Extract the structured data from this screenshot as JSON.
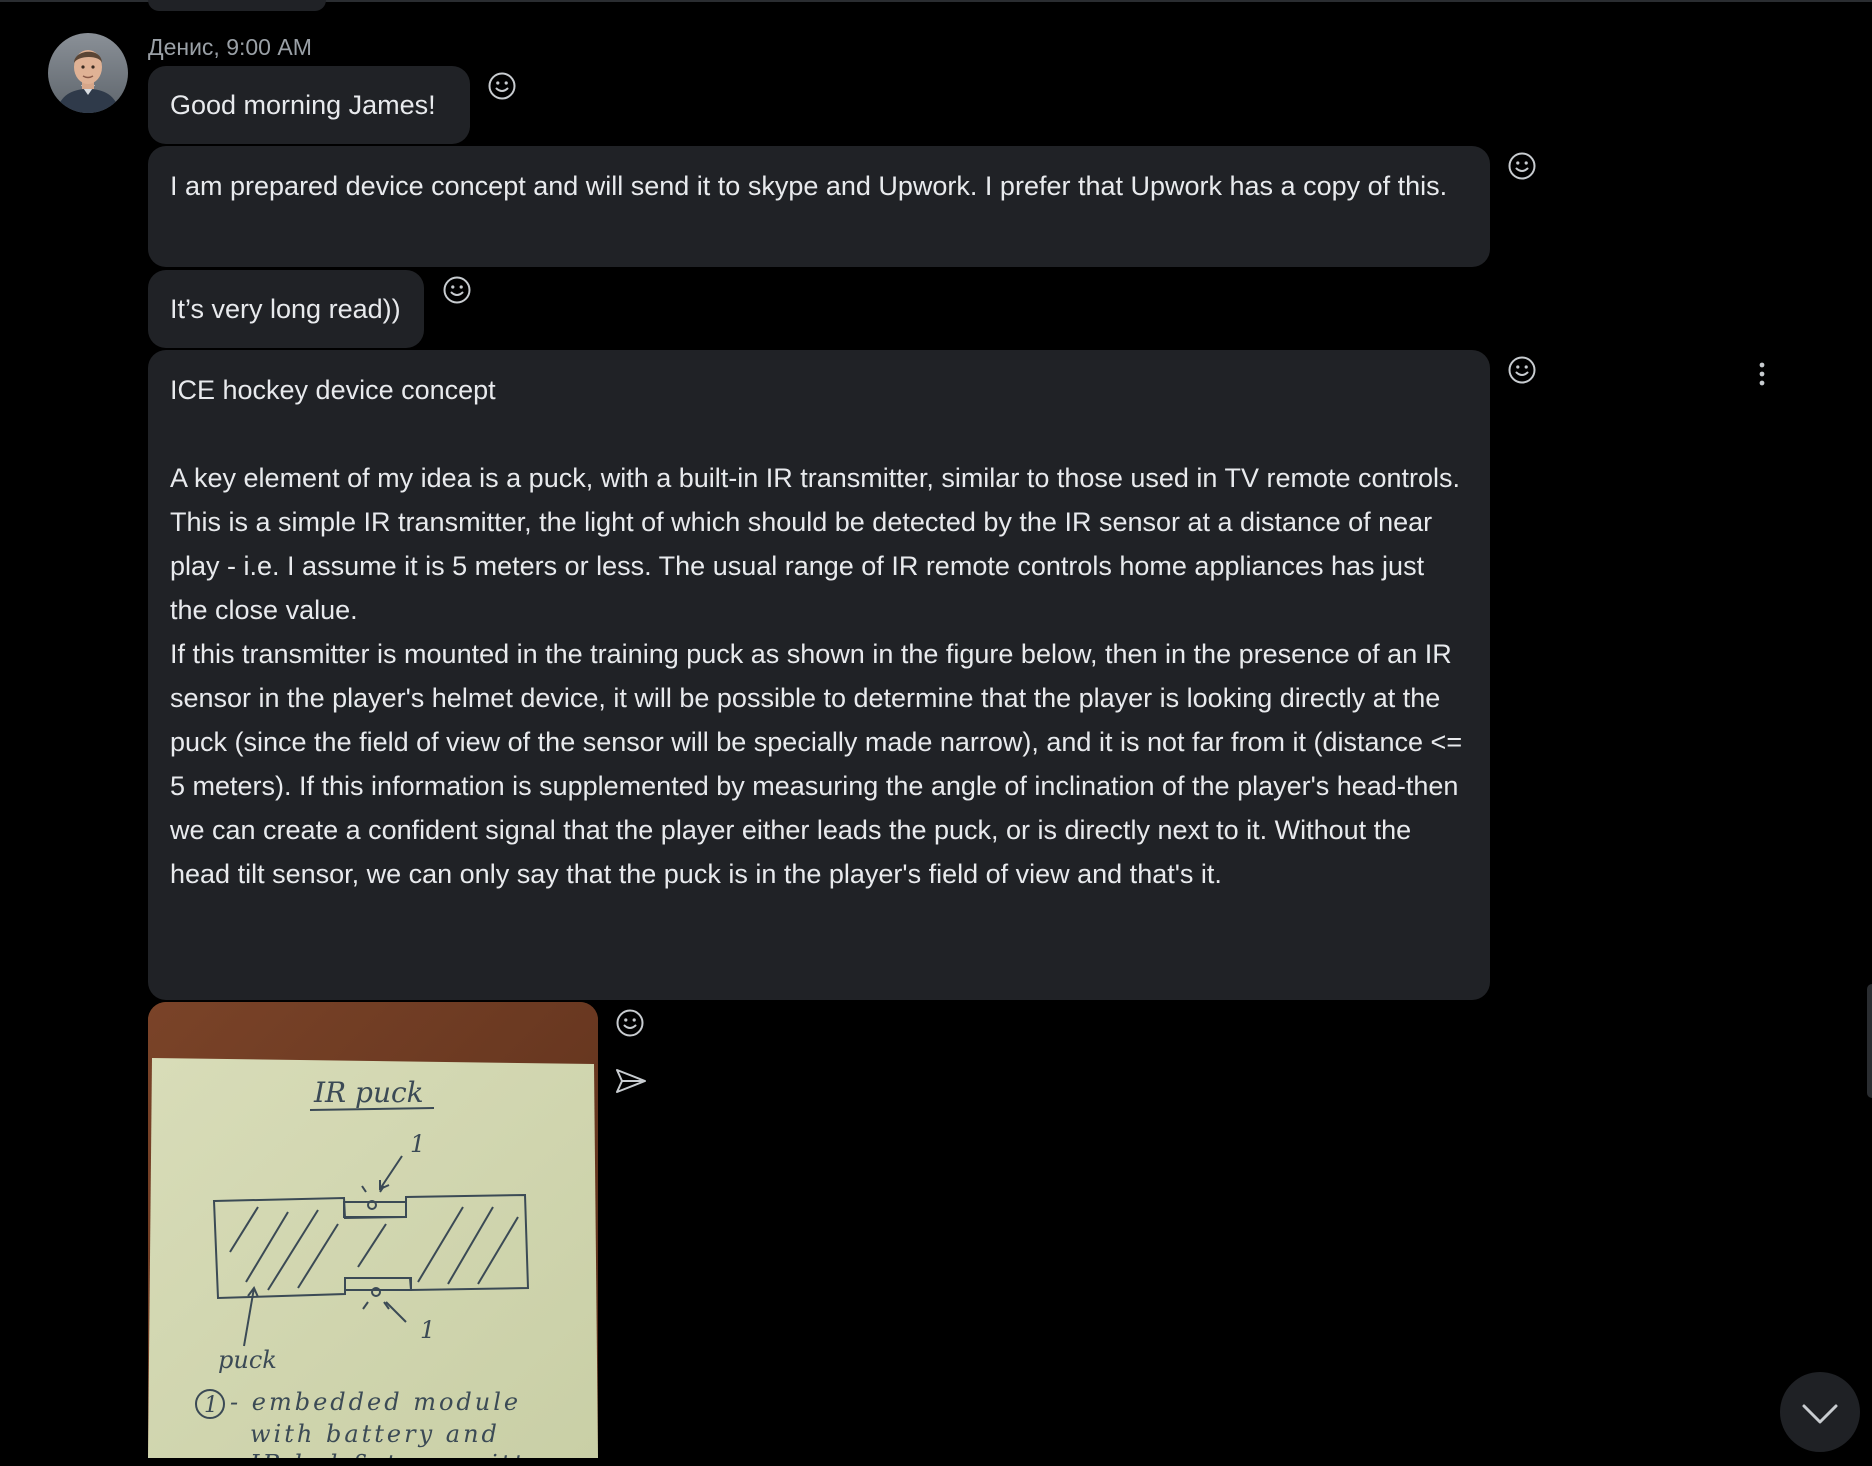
{
  "message_group": {
    "sender": "Денис",
    "time": "9:00 AM",
    "meta": "Денис, 9:00 AM"
  },
  "messages": [
    {
      "text": "Good morning James!"
    },
    {
      "text": "I am prepared device concept and will send it to skype and Upwork.  I prefer that Upwork has a copy of this."
    },
    {
      "text": "It’s very long read))"
    },
    {
      "title": "ICE hockey device concept",
      "paragraphs": [
        "A key element of my idea is a puck, with a built-in IR transmitter, similar to those used in TV remote controls.",
        "This is a simple IR transmitter, the light of which should be detected by the IR sensor at a distance of near play - i.e. I assume it is 5 meters or less. The usual range of IR remote controls home appliances has just the close value.",
        "If this transmitter is mounted in the training puck as shown in the figure below, then in the presence of an IR sensor in the player's helmet device, it will be possible to determine that the player is looking directly at the puck (since the field of view of the sensor will be specially made narrow), and it is not far from it (distance <= 5 meters). If this information is supplemented by measuring the angle of inclination of the player's head-then we can create a confident signal that the player either leads the puck, or is directly next to it. Without the head tilt sensor, we can only say that the puck is in the player's field of view and that's it."
      ]
    }
  ],
  "attachment": {
    "sketch_title": "IR puck",
    "label_1_top": "1",
    "label_1_bottom": "1",
    "label_puck": "puck",
    "legend_num": "1",
    "legend_line1": "- embedded module",
    "legend_line2": "with battery and",
    "legend_line3": "IR led & transmitter"
  },
  "icons": {
    "reaction": "smiley-icon",
    "more": "vertical-ellipsis-icon",
    "forward": "send-arrow-icon",
    "scroll_down": "chevron-down-icon"
  },
  "colors": {
    "background": "#000000",
    "bubble": "#202226",
    "text": "#e8eaed",
    "meta": "#9aa0a6",
    "icon": "#c8ccd0"
  }
}
